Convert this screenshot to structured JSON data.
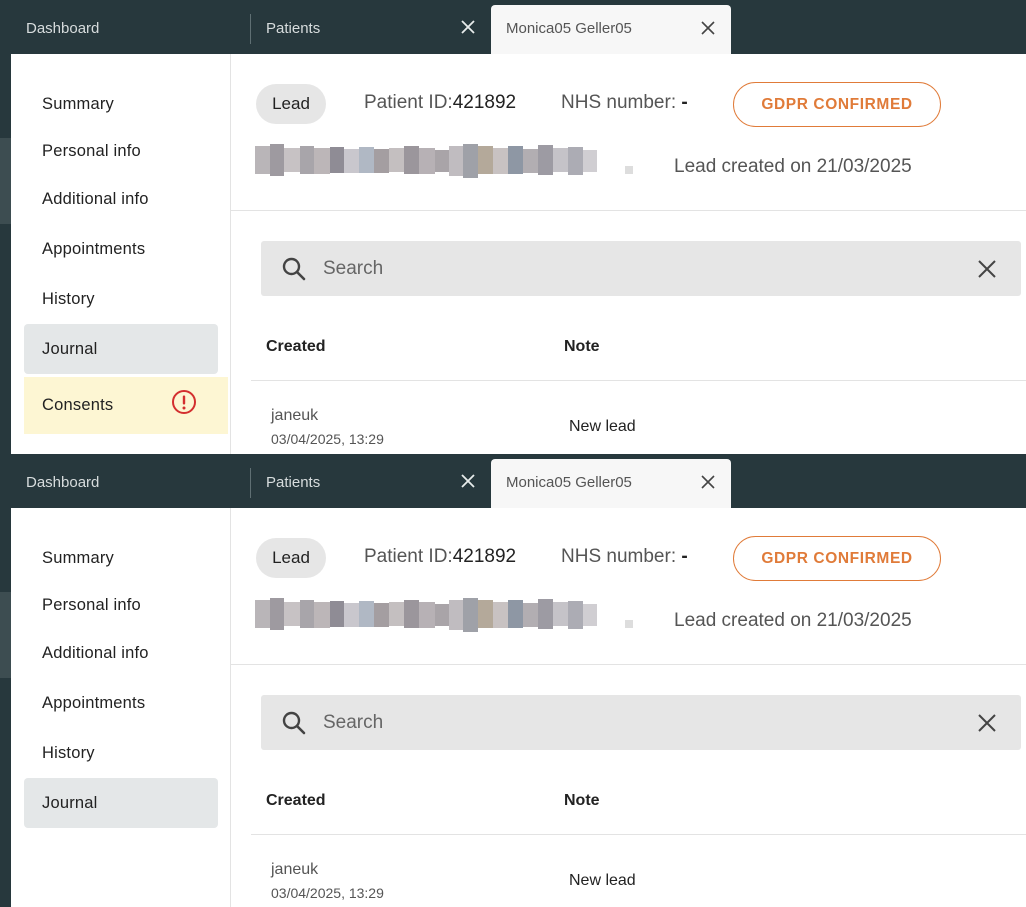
{
  "tabs": {
    "dashboard": "Dashboard",
    "patients": "Patients",
    "active": "Monica05 Geller05"
  },
  "sidebar": {
    "items": [
      {
        "label": "Summary"
      },
      {
        "label": "Personal info"
      },
      {
        "label": "Additional info"
      },
      {
        "label": "Appointments"
      },
      {
        "label": "History"
      },
      {
        "label": "Journal"
      },
      {
        "label": "Consents"
      }
    ]
  },
  "header": {
    "status_badge": "Lead",
    "patient_id_label": "Patient ID:",
    "patient_id_value": "421892",
    "nhs_label": "NHS number: ",
    "nhs_value": "-",
    "gdpr_button": "GDPR CONFIRMED",
    "lead_created": "Lead created on 21/03/2025"
  },
  "search": {
    "placeholder": "Search"
  },
  "table": {
    "columns": [
      "Created",
      "Note"
    ],
    "rows": [
      {
        "user": "janeuk",
        "date": "03/04/2025, 13:29",
        "note": "New lead"
      }
    ]
  },
  "colors": {
    "topbar": "#27383d",
    "accent": "#e07b39",
    "warning": "#d32f2f",
    "consent_bg": "#fdf6d3"
  }
}
